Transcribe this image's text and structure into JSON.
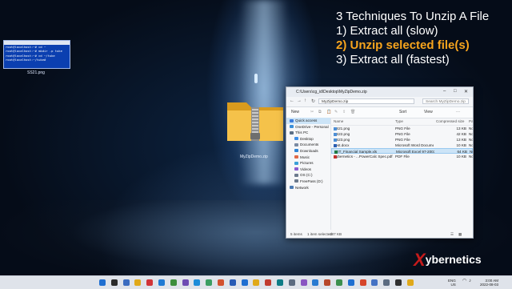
{
  "overlay": {
    "title": "3 Techniques To Unzip A File",
    "items": [
      "1) Extract all (slow)",
      "2) Unzip selected file(s)",
      "3) Extract all (fastest)"
    ]
  },
  "desktop": {
    "mini_terminal": {
      "lines": [
        "root@localhost:~# cd ~",
        "root@localhost:~# mkdir -p tuke",
        "root@localhost:~# cd ~/tuke",
        "root@localhost:~/tuke#"
      ]
    },
    "mini_label": "SS21.png",
    "zip_label": "MyZipDemo.zip"
  },
  "explorer": {
    "title_path": "C:\\Users\\cg_id\\Desktop\\MyZipDemo.zip",
    "address": "MyZipDemo.zip",
    "search_placeholder": "Search MyZipDemo.zip",
    "commands": {
      "new": "New",
      "sort": "Sort",
      "view": "View"
    },
    "sidebar": [
      {
        "label": "Quick access",
        "color": "#3b7ddd",
        "sel": true
      },
      {
        "label": "OneDrive - Personal",
        "color": "#3a8fd9",
        "sel": false
      },
      {
        "label": "This PC",
        "color": "#5c6f86",
        "sel": false
      },
      {
        "label": "Desktop",
        "color": "#3d8ee6",
        "sel": false
      },
      {
        "label": "Documents",
        "color": "#7a8aa2",
        "sel": false
      },
      {
        "label": "Downloads",
        "color": "#2f86d6",
        "sel": false
      },
      {
        "label": "Music",
        "color": "#e06a48",
        "sel": false
      },
      {
        "label": "Pictures",
        "color": "#3aa0d8",
        "sel": false
      },
      {
        "label": "Videos",
        "color": "#8a5bd1",
        "sel": false
      },
      {
        "label": "OS (C:)",
        "color": "#6c7a8d",
        "sel": false
      },
      {
        "label": "FreePass (D:)",
        "color": "#6c7a8d",
        "sel": false
      },
      {
        "label": "Network",
        "color": "#4b7bb5",
        "sel": false
      }
    ],
    "columns": {
      "name": "Name",
      "type": "Type",
      "compressed": "Compressed size",
      "pw": "Pa"
    },
    "files": [
      {
        "name": "SS21.png",
        "type": "PNG File",
        "size": "13 KB",
        "pw": "No",
        "sel": false,
        "color": "#4d8fd6"
      },
      {
        "name": "SS22.png",
        "type": "PNG File",
        "size": "42 KB",
        "pw": "No",
        "sel": false,
        "color": "#4d8fd6"
      },
      {
        "name": "SS23.png",
        "type": "PNG File",
        "size": "13 KB",
        "pw": "No",
        "sel": false,
        "color": "#4d8fd6"
      },
      {
        "name": "Test.docx",
        "type": "Microsoft Word Document",
        "size": "10 KB",
        "pw": "No",
        "sel": false,
        "color": "#2b5fb3"
      },
      {
        "name": "WIT_Financial Sample.xls",
        "type": "Microsoft Excel 97-2003 ...",
        "size": "64 KB",
        "pw": "No",
        "sel": true,
        "color": "#1e7b45"
      },
      {
        "name": "Xybernetics - ...PowerCalc Spec.pdf",
        "type": "PDF File",
        "size": "10 KB",
        "pw": "No",
        "sel": false,
        "color": "#c3312f"
      }
    ],
    "status": {
      "items": "5 items",
      "selected": "1 item selected",
      "size": "187 KB"
    }
  },
  "logo": {
    "x": "X",
    "text": "ybernetics"
  },
  "taskbar": {
    "icons": [
      "#1f6fd1",
      "#2b2b2b",
      "#3b6cc0",
      "#e0a91a",
      "#d13438",
      "#1f7ad4",
      "#3d8f3d",
      "#6d4bb3",
      "#1c8cd9",
      "#3b9e62",
      "#d35230",
      "#285bb5",
      "#1f6fd1",
      "#e0a91a",
      "#c13b2f",
      "#0e7c86",
      "#5b6b80",
      "#8a56c2",
      "#2a7bd1",
      "#b7472a",
      "#3c8f4e",
      "#1f6fd1",
      "#d6452b",
      "#4472c4",
      "#5b6b80",
      "#2f2f2f",
      "#e0a91a"
    ],
    "lang_top": "ENG",
    "lang_bottom": "US",
    "time": "3:00 AM",
    "date": "2022-08-03"
  }
}
